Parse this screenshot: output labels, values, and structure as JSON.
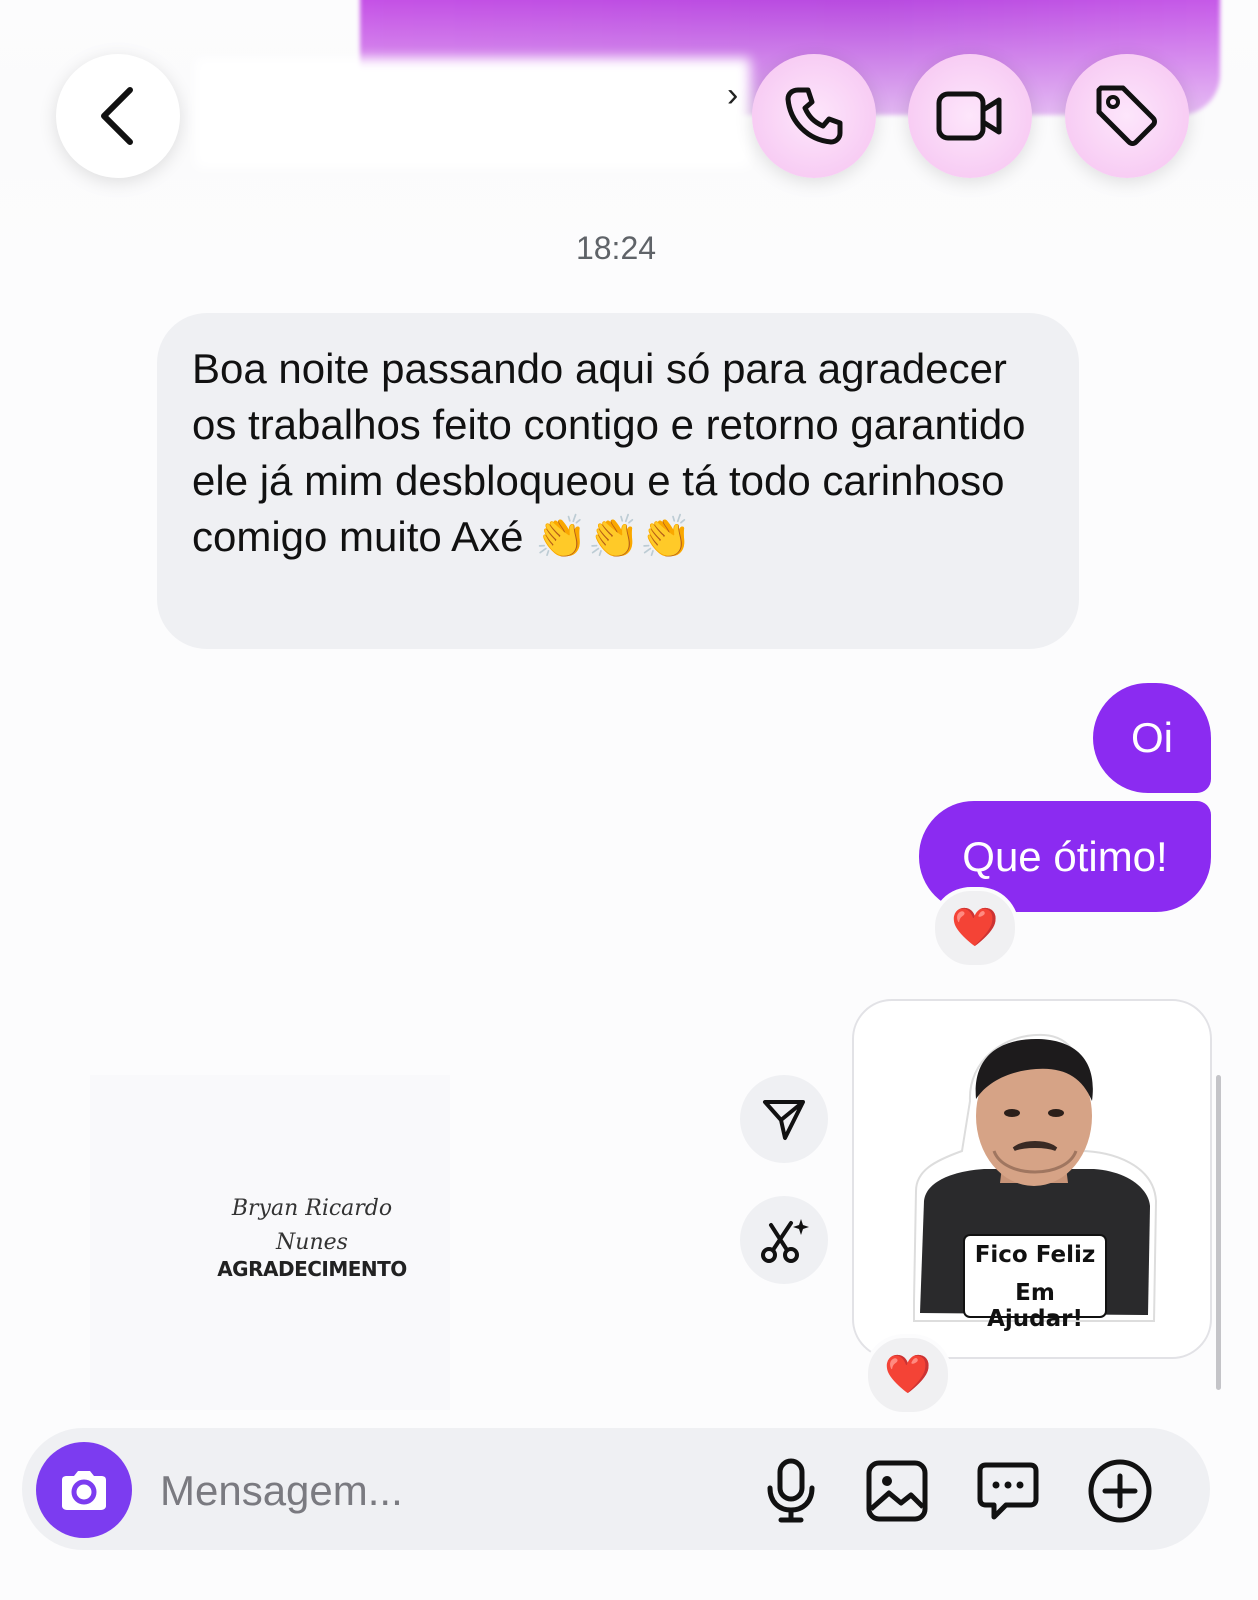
{
  "header": {
    "back_icon": "chevron-left-icon",
    "actions": [
      {
        "name": "call",
        "icon": "phone-icon"
      },
      {
        "name": "video",
        "icon": "video-camera-icon"
      },
      {
        "name": "tag",
        "icon": "tag-icon"
      }
    ]
  },
  "timestamp": "18:24",
  "messages": {
    "incoming_1": "Boa noite passando aqui só para agradecer os trabalhos feito contigo e retorno garantido ele já mim desbloqueou e tá todo carinhoso comigo muito Axé 👏👏👏",
    "outgoing_1": "Oi",
    "outgoing_2": "Que ótimo!",
    "reaction_1": "❤️",
    "reaction_2": "❤️"
  },
  "sticker": {
    "caption_line1": "Fico Feliz",
    "caption_line2": "Em Ajudar!"
  },
  "watermark": {
    "script_line1": "Bryan Ricardo",
    "script_line2": "Nunes",
    "word": "AGRADECIMENTO"
  },
  "composer": {
    "placeholder": "Mensagem...",
    "icons": [
      "camera-icon",
      "microphone-icon",
      "gallery-icon",
      "sticker-icon",
      "plus-icon"
    ]
  },
  "colors": {
    "accent": "#8b2bf1",
    "camera_button": "#7c3cf0",
    "incoming_bubble": "#eff0f3",
    "header_gradient": "#c552e6"
  }
}
